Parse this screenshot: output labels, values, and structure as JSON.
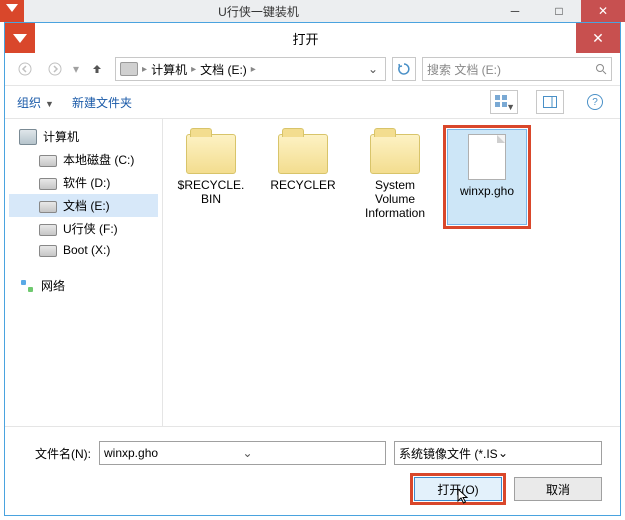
{
  "parent_window": {
    "title": "U行侠一键装机"
  },
  "dialog": {
    "title": "打开"
  },
  "nav": {
    "breadcrumb": [
      "计算机",
      "文档 (E:)"
    ],
    "search_placeholder": "搜索 文档 (E:)"
  },
  "toolbar": {
    "organize": "组织",
    "new_folder": "新建文件夹"
  },
  "tree": {
    "root": "计算机",
    "items": [
      {
        "label": "本地磁盘 (C:)",
        "selected": false
      },
      {
        "label": "软件 (D:)",
        "selected": false
      },
      {
        "label": "文档 (E:)",
        "selected": true
      },
      {
        "label": "U行侠 (F:)",
        "selected": false
      },
      {
        "label": "Boot (X:)",
        "selected": false
      }
    ],
    "network": "网络"
  },
  "files": [
    {
      "name": "$RECYCLE.BIN",
      "kind": "folder",
      "selected": false,
      "highlight": false
    },
    {
      "name": "RECYCLER",
      "kind": "folder",
      "selected": false,
      "highlight": false
    },
    {
      "name": "System Volume Information",
      "kind": "folder",
      "selected": false,
      "highlight": false
    },
    {
      "name": "winxp.gho",
      "kind": "file",
      "selected": true,
      "highlight": true
    }
  ],
  "bottom": {
    "filename_label": "文件名(N):",
    "filename_value": "winxp.gho",
    "filetype_value": "系统镜像文件 (*.ISO;*.GHO;*.WIM)",
    "open_label": "打开(O)",
    "cancel_label": "取消"
  }
}
